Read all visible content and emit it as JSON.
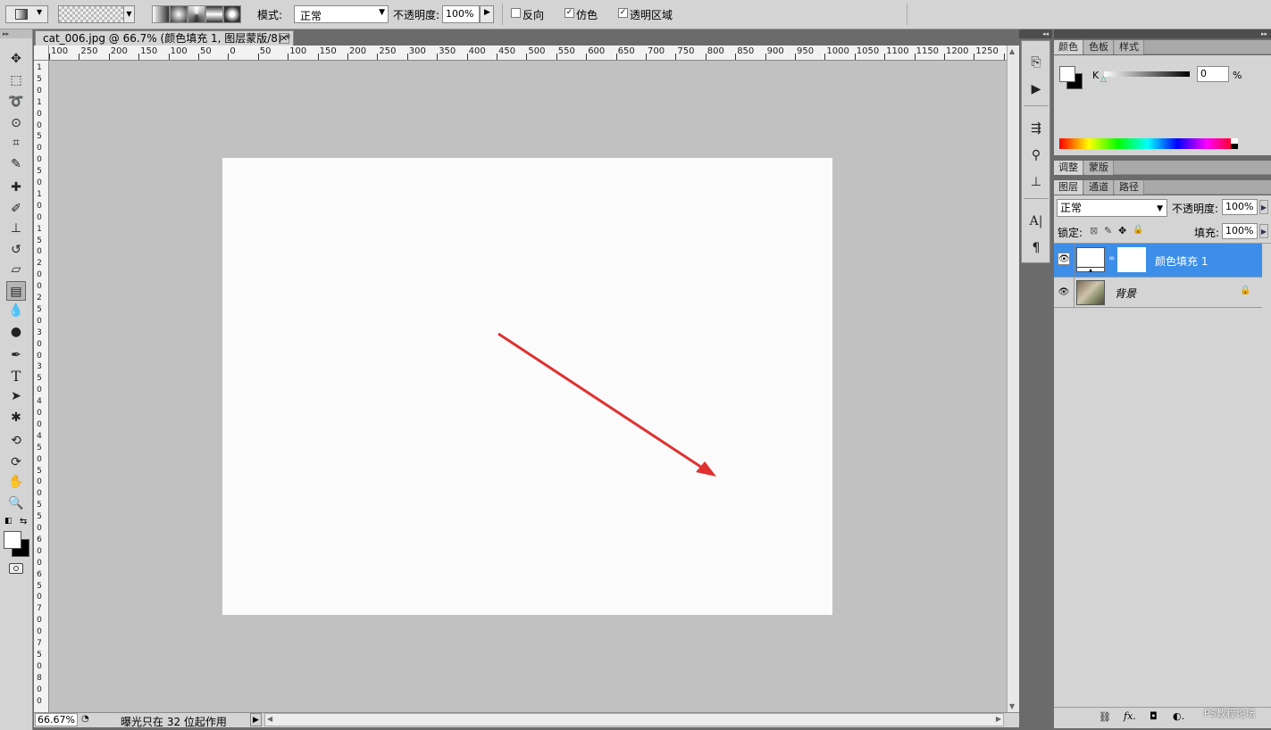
{
  "options_bar": {
    "mode_label": "模式:",
    "mode_value": "正常",
    "opacity_label": "不透明度:",
    "opacity_value": "100%",
    "reverse_label": "反向",
    "reverse_checked": false,
    "dither_label": "仿色",
    "dither_checked": true,
    "transparency_label": "透明区域",
    "transparency_checked": true
  },
  "document": {
    "tab_title": "cat_006.jpg @ 66.7% (颜色填充 1, 图层蒙版/8) *",
    "close_glyph": "✕",
    "canvas_color": "#fbfbfb",
    "arrow_color": "#e03131"
  },
  "ruler": {
    "h_labels": [
      "100",
      "250",
      "200",
      "150",
      "100",
      "50",
      "0",
      "50",
      "100",
      "150",
      "200",
      "250",
      "300",
      "350",
      "400",
      "450",
      "500",
      "550",
      "600",
      "650",
      "700",
      "750",
      "800",
      "850",
      "900",
      "950",
      "1000",
      "1050",
      "1100",
      "1150",
      "1200",
      "1250",
      "13"
    ],
    "v_labels": [
      "1",
      "5",
      "0",
      "1",
      "0",
      "0",
      "5",
      "0",
      "0",
      "5",
      "0",
      "1",
      "0",
      "0",
      "1",
      "5",
      "0",
      "2",
      "0",
      "0",
      "2",
      "5",
      "0",
      "3",
      "0",
      "0",
      "3",
      "5",
      "0",
      "4",
      "0",
      "0",
      "4",
      "5",
      "0",
      "5",
      "0",
      "0",
      "5",
      "5",
      "0",
      "6",
      "0",
      "0",
      "6",
      "5",
      "0",
      "7",
      "0",
      "0",
      "7",
      "5",
      "0",
      "8",
      "0",
      "0"
    ]
  },
  "status": {
    "zoom": "66.67%",
    "info": "曝光只在 32 位起作用"
  },
  "color_panel": {
    "tabs": [
      "颜色",
      "色板",
      "样式"
    ],
    "channel_label": "K",
    "channel_value": "0",
    "unit": "%"
  },
  "adjust_panel": {
    "tabs": [
      "调整",
      "蒙版"
    ]
  },
  "layers_panel": {
    "tabs": [
      "图层",
      "通道",
      "路径"
    ],
    "blend_mode": "正常",
    "opacity_label": "不透明度:",
    "opacity_value": "100%",
    "lock_label": "锁定:",
    "fill_label": "填充:",
    "fill_value": "100%",
    "layers": [
      {
        "name": "颜色填充 1",
        "selected": true
      },
      {
        "name": "背景",
        "selected": false
      }
    ],
    "bottom_icons": [
      "link-icon",
      "fx-icon",
      "mask-icon",
      "adjustment-icon"
    ],
    "watermark": "PS教程论坛"
  },
  "colors": {
    "selection_blue": "#3d8ee8",
    "panel_gray": "#d4d4d4"
  }
}
